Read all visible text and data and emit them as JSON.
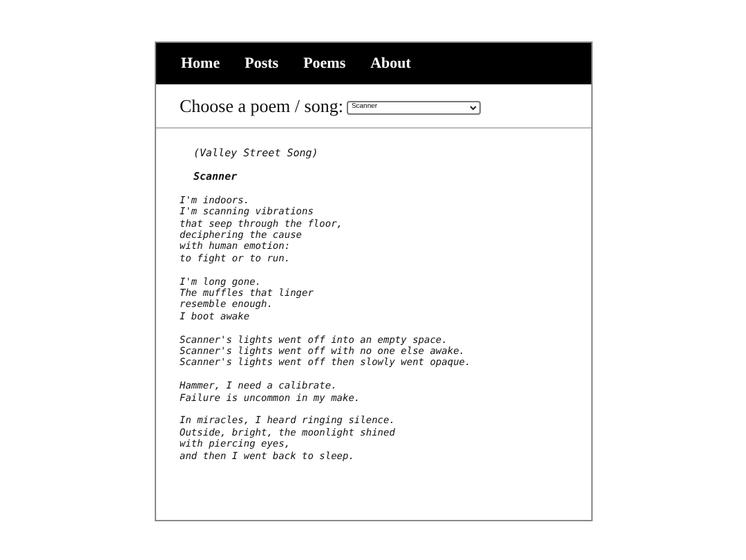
{
  "nav": [
    "Home",
    "Posts",
    "Poems",
    "About"
  ],
  "chooser": {
    "label": "Choose a poem / song:",
    "value": "Scanner"
  },
  "poem": {
    "subtitle": "(Valley Street Song)",
    "title": "Scanner",
    "stanzas": [
      [
        "I'm indoors.",
        "I'm scanning vibrations",
        "that seep through the floor,",
        "deciphering the cause",
        "with human emotion:",
        "to fight or to run."
      ],
      [
        "I'm long gone.",
        "The muffles that linger",
        "resemble enough.",
        "I boot awake"
      ],
      [
        "Scanner's lights went off into an empty space.",
        "Scanner's lights went off with no one else awake.",
        "Scanner's lights went off then slowly went opaque."
      ],
      [
        "Hammer, I need a calibrate.",
        "Failure is uncommon in my make."
      ],
      [
        "In miracles, I heard ringing silence.",
        "Outside, bright, the moonlight shined",
        "with piercing eyes,",
        "and then I went back to sleep."
      ]
    ]
  }
}
